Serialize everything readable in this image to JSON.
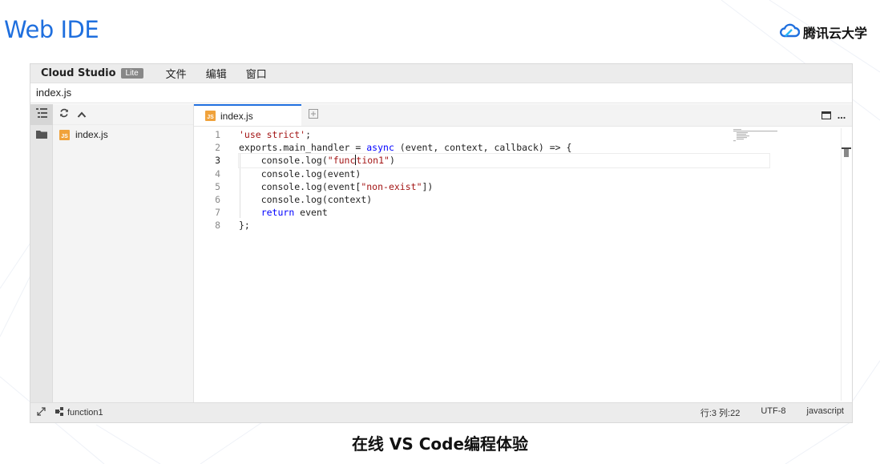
{
  "slide": {
    "title": "Web IDE",
    "brand": "腾讯云大学",
    "caption": "在线 VS Code编程体验"
  },
  "ide": {
    "app_name": "Cloud Studio",
    "badge": "Lite",
    "menu": [
      "文件",
      "编辑",
      "窗口"
    ],
    "file_path": "index.js",
    "explorer": {
      "files": [
        {
          "name": "index.js",
          "icon": "js-file-icon"
        }
      ]
    },
    "tabs": [
      {
        "label": "index.js",
        "icon": "js-file-icon",
        "active": true
      }
    ],
    "editor": {
      "current_line": 3,
      "line_numbers": [
        "1",
        "2",
        "3",
        "4",
        "5",
        "6",
        "7",
        "8"
      ]
    },
    "status": {
      "outline_item": "function1",
      "cursor": "行:3 列:22",
      "encoding": "UTF-8",
      "language": "javascript"
    }
  },
  "colors": {
    "title_blue": "#1f6fde",
    "js_icon": "#f0a23b",
    "string": "#a31515",
    "keyword": "#0000ff"
  }
}
